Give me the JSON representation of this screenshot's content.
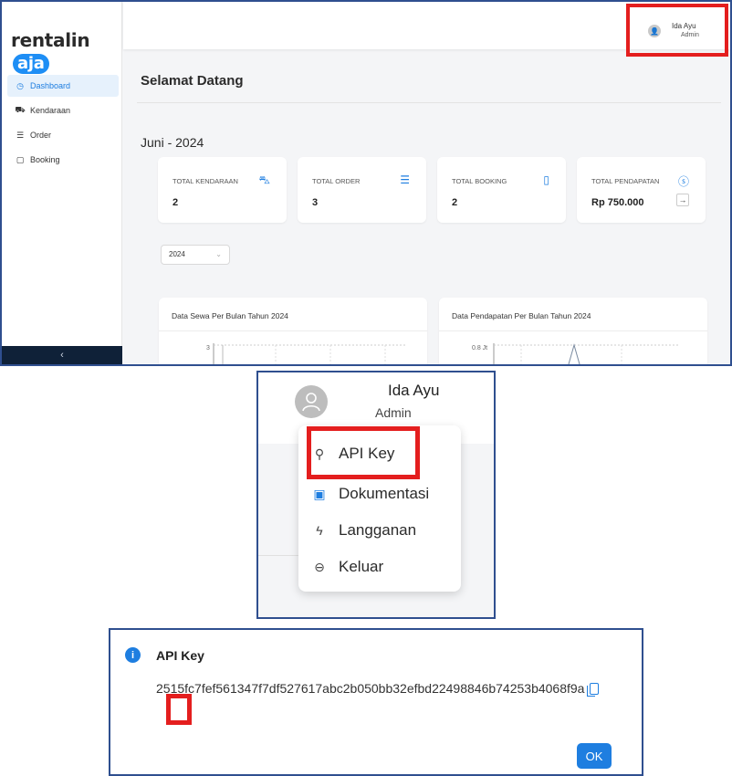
{
  "brand": {
    "name_part1": "rentalin",
    "name_part2": "aja"
  },
  "sidebar": {
    "items": [
      {
        "label": "Dashboard",
        "icon": "dashboard-icon",
        "active": true
      },
      {
        "label": "Kendaraan",
        "icon": "vehicle-icon",
        "active": false
      },
      {
        "label": "Order",
        "icon": "list-icon",
        "active": false
      },
      {
        "label": "Booking",
        "icon": "bookmark-icon",
        "active": false
      }
    ],
    "collapse_label": "‹"
  },
  "user": {
    "name": "Ida Ayu",
    "role": "Admin"
  },
  "main": {
    "welcome": "Selamat Datang",
    "period": "Juni - 2024",
    "cards": [
      {
        "label": "TOTAL KENDARAAN",
        "value": "2",
        "icon": "car-icon"
      },
      {
        "label": "TOTAL ORDER",
        "value": "3",
        "icon": "list-icon"
      },
      {
        "label": "TOTAL BOOKING",
        "value": "2",
        "icon": "bookmark-icon"
      },
      {
        "label": "TOTAL PENDAPATAN",
        "value": "Rp 750.000",
        "icon": "dollar-icon"
      }
    ],
    "year_select": "2024",
    "charts": [
      {
        "title": "Data Sewa Per Bulan Tahun 2024",
        "y_tick": "3"
      },
      {
        "title": "Data Pendapatan Per Bulan Tahun 2024",
        "y_tick": "0.8 Jt"
      }
    ]
  },
  "dropdown": {
    "items": [
      {
        "label": "API Key",
        "icon": "search-key-icon"
      },
      {
        "label": "Dokumentasi",
        "icon": "document-icon"
      },
      {
        "label": "Langganan",
        "icon": "lightning-icon"
      },
      {
        "label": "Keluar",
        "icon": "logout-icon"
      }
    ]
  },
  "modal": {
    "title": "API Key",
    "key_value": "2515fc7fef561347f7df527617abc2b050bb32efbd22498846b74253b4068f9a",
    "ok_label": "OK"
  },
  "colors": {
    "accent": "#1e7ee0",
    "highlight": "#e41e1e",
    "frame": "#2f4f8f",
    "sidebar_bottom": "#0f2138"
  }
}
